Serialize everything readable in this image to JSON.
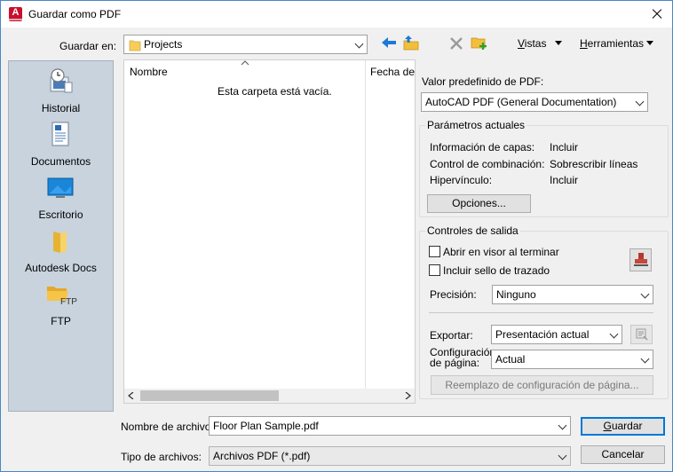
{
  "window": {
    "title": "Guardar como PDF"
  },
  "toolbar": {
    "save_in_label": "Guardar en:",
    "location": "Projects",
    "views_label": "Vistas",
    "tools_label": "Herramientas"
  },
  "places": [
    {
      "label": "Historial",
      "icon": "history-icon"
    },
    {
      "label": "Documentos",
      "icon": "documents-icon"
    },
    {
      "label": "Escritorio",
      "icon": "desktop-icon"
    },
    {
      "label": "Autodesk Docs",
      "icon": "folder-icon"
    },
    {
      "label": "FTP",
      "icon": "ftp-folder-icon",
      "badge": "FTP"
    }
  ],
  "filelist": {
    "col_name": "Nombre",
    "col_date": "Fecha de",
    "empty_text": "Esta carpeta está vacía."
  },
  "pdf": {
    "preset_label": "Valor predefinido de PDF:",
    "preset_value": "AutoCAD PDF (General Documentation)"
  },
  "current_params": {
    "title": "Parámetros actuales",
    "rows": [
      {
        "label": "Información de capas:",
        "value": "Incluir"
      },
      {
        "label": "Control de combinación:",
        "value": "Sobrescribir líneas"
      },
      {
        "label": "Hipervínculo:",
        "value": "Incluir"
      }
    ],
    "options_button": "Opciones..."
  },
  "output": {
    "title": "Controles de salida",
    "open_viewer": "Abrir en visor al terminar",
    "include_stamp": "Incluir sello de trazado",
    "precision_label": "Precisión:",
    "precision_value": "Ninguno",
    "export_label": "Exportar:",
    "export_value": "Presentación actual",
    "page_config_label_1": "Configuración",
    "page_config_label_2": "de página:",
    "page_config_value": "Actual",
    "page_override_button": "Reemplazo de configuración de página..."
  },
  "footer": {
    "filename_label": "Nombre de archivo:",
    "filename_value": "Floor Plan Sample.pdf",
    "filetype_label": "Tipo de archivos:",
    "filetype_value": "Archivos PDF (*.pdf)",
    "save_button": "Guardar",
    "cancel_button": "Cancelar"
  },
  "colors": {
    "accent": "#1e78d7",
    "places_bg": "#c8d3dd",
    "brand_red": "#c8102e"
  }
}
